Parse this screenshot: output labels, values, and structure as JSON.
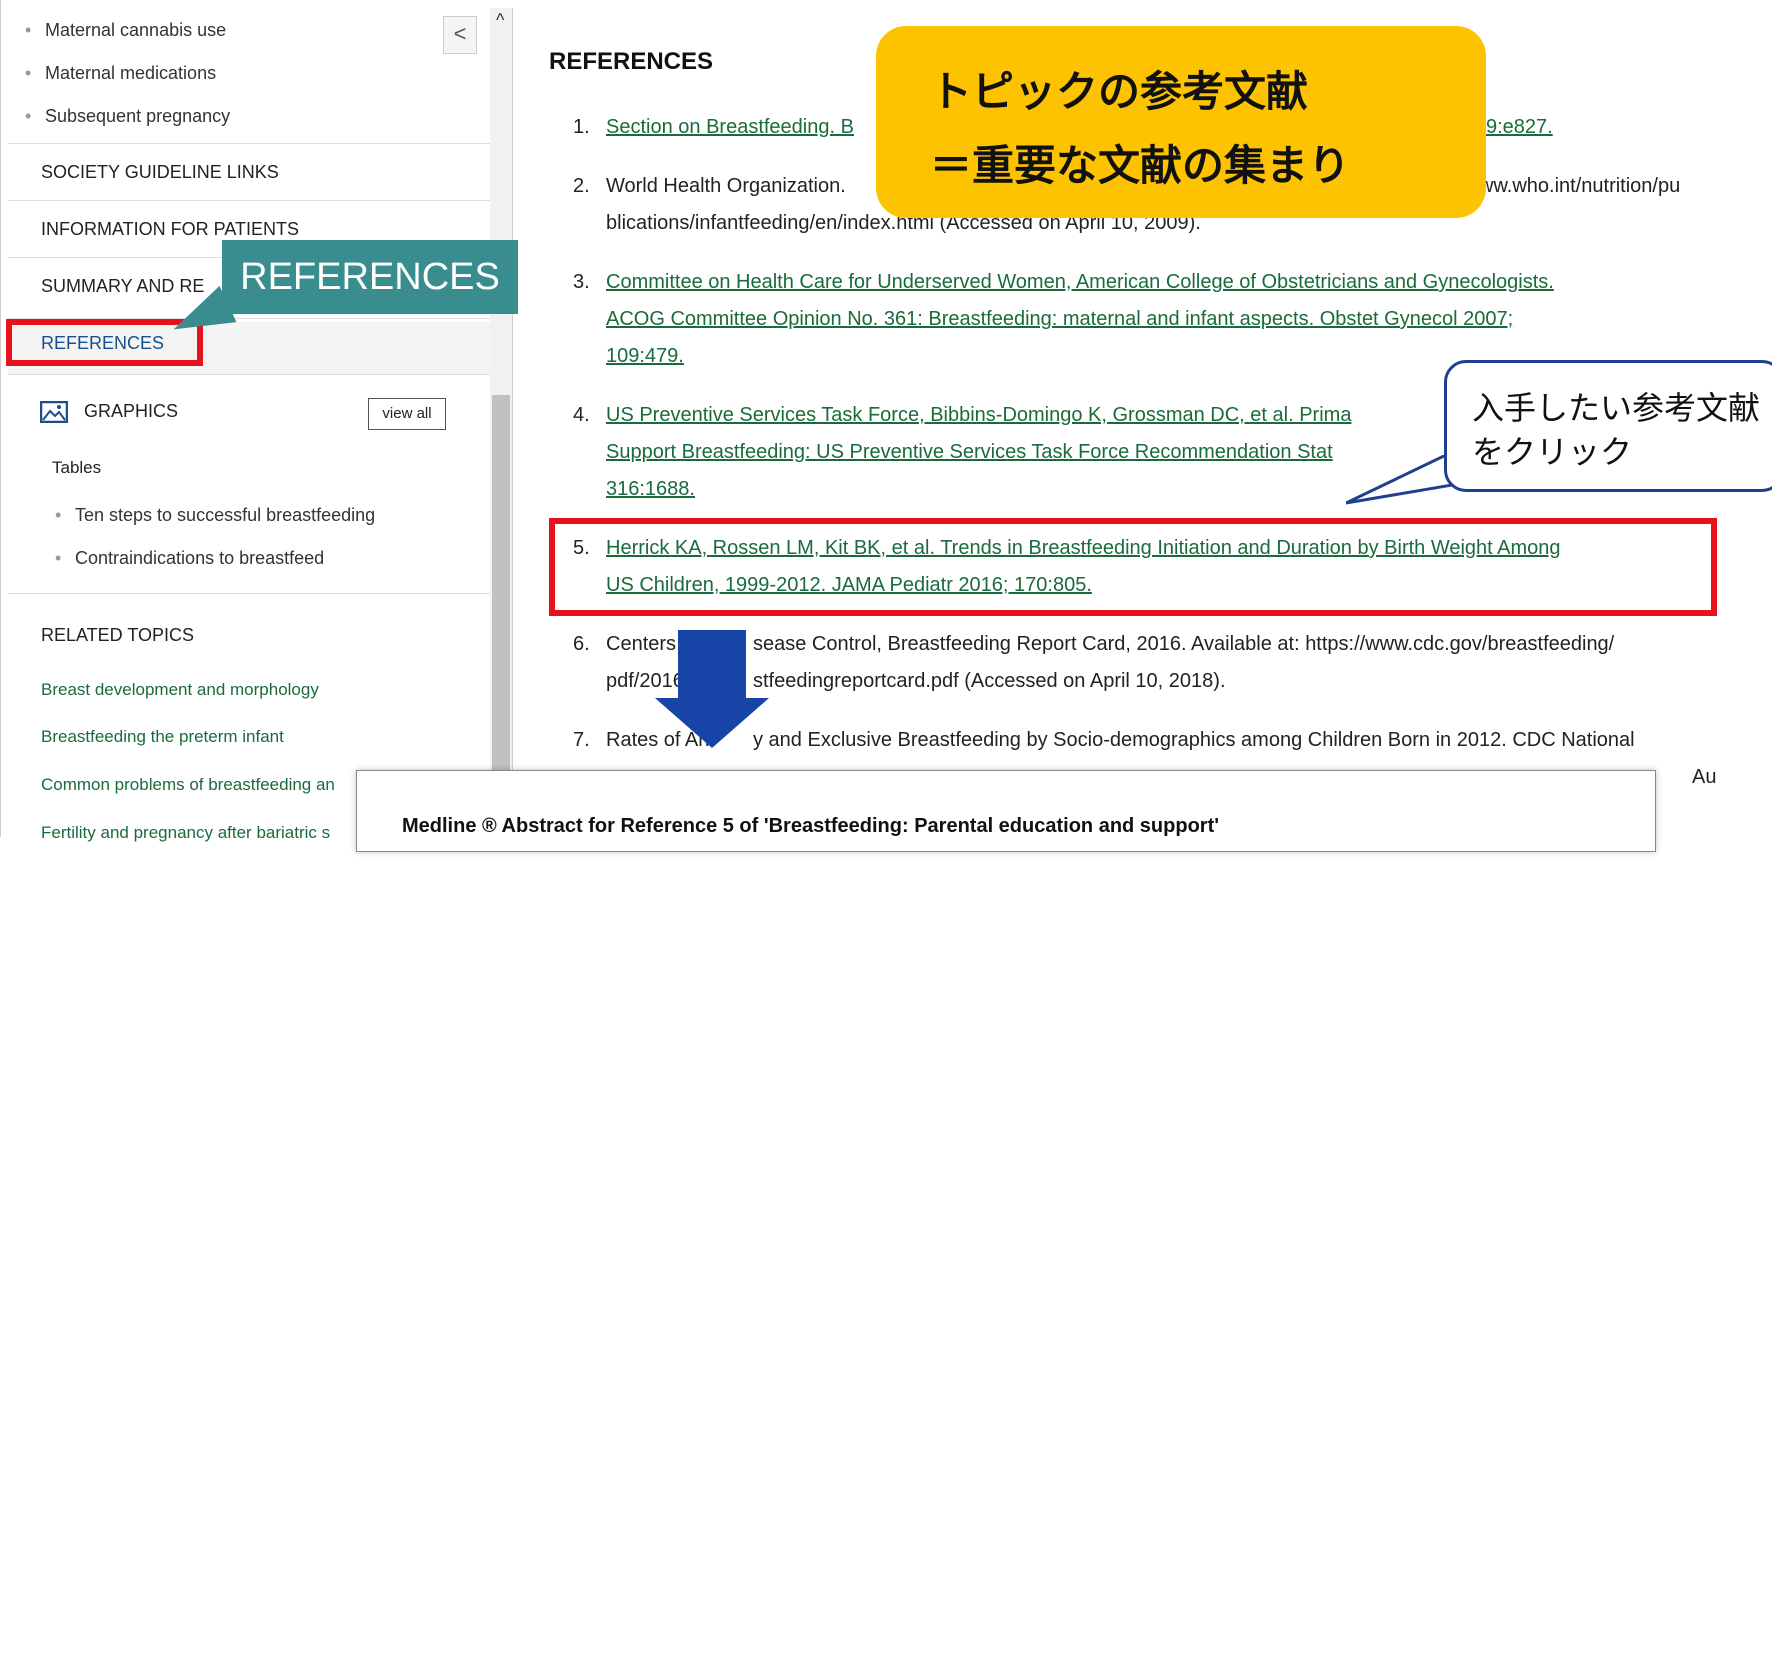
{
  "sidebar": {
    "bullets_top": [
      "Maternal cannabis use",
      "Maternal medications",
      "Subsequent pregnancy"
    ],
    "sections": {
      "society": "SOCIETY GUIDELINE LINKS",
      "patients": "INFORMATION FOR PATIENTS",
      "summary": "SUMMARY AND RE",
      "references": "REFERENCES",
      "graphics": "GRAPHICS",
      "view_all": "view all",
      "tables": "Tables",
      "related": "RELATED TOPICS"
    },
    "tables": [
      "Ten steps to successful breastfeeding",
      "Contraindications to breastfeed"
    ],
    "related_topics": [
      "Breast development and morphology",
      "Breastfeeding the preterm infant",
      "Common problems of breastfeeding an",
      "Fertility and pregnancy after bariatric s"
    ],
    "collapse_icon": "<"
  },
  "main": {
    "title": "REFERENCES",
    "refs": [
      {
        "num": "1.",
        "lines": [
          "Section on Breastfeeding. B",
          "9:e827."
        ]
      },
      {
        "num": "2.",
        "lines": [
          "World Health Organization.",
          "ww.who.int/nutrition/pu",
          "blications/infantfeeding/en/index.html (Accessed on April 10, 2009)."
        ]
      },
      {
        "num": "3.",
        "lines": [
          "Committee on Health Care for Underserved Women, American College of Obstetricians and Gynecologists.",
          "ACOG Committee Opinion No. 361: Breastfeeding: maternal and infant aspects. Obstet Gynecol 2007;",
          "109:479."
        ]
      },
      {
        "num": "4.",
        "lines": [
          "US Preventive Services Task Force, Bibbins-Domingo K, Grossman DC, et al. Prima",
          "Support Breastfeeding: US Preventive Services Task Force Recommendation Stat",
          "316:1688."
        ]
      },
      {
        "num": "5.",
        "lines": [
          "Herrick KA, Rossen LM, Kit BK, et al. Trends in Breastfeeding Initiation and Duration by Birth Weight Among",
          "US Children, 1999-2012. JAMA Pediatr 2016; 170:805."
        ]
      },
      {
        "num": "6.",
        "lines": [
          "Centers fo",
          "sease Control, Breastfeeding Report Card, 2016. Available at: https://www.cdc.gov/breastfeeding/",
          "pdf/2016b",
          "stfeedingreportcard.pdf (Accessed on April 10, 2018)."
        ]
      },
      {
        "num": "7.",
        "lines": [
          "Rates of An",
          "y and Exclusive Breastfeeding by Socio-demographics among Children Born in 2012. CDC National",
          "Au"
        ]
      }
    ]
  },
  "callouts": {
    "yellow_line1": "トピックの参考文献",
    "yellow_line2": "＝重要な文献の集まり",
    "teal": "REFERENCES",
    "blue_line1": "入手したい参考文献",
    "blue_line2": "をクリック"
  },
  "modal": {
    "title": "Medline ® Abstract for Reference 5 of 'Breastfeeding: Parental education and support'"
  },
  "colors": {
    "link": "#1a6b3c",
    "highlight_red": "#e5141c",
    "callout_yellow": "#fdc300",
    "teal": "#3a8d8f",
    "arrow_blue": "#1744a6"
  }
}
